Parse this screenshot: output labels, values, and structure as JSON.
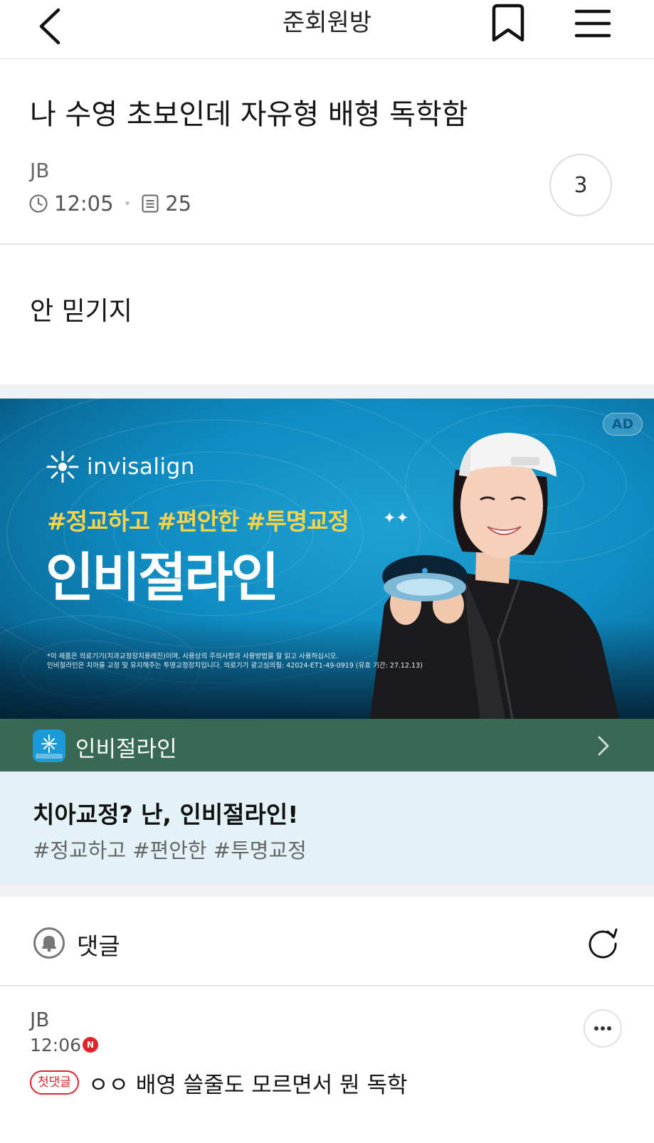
{
  "header": {
    "title": "준회원방"
  },
  "post": {
    "title": "나 수영 초보인데 자유형 배형 독학함",
    "author": "JB",
    "time": "12:05",
    "views": "25",
    "comment_count": "3",
    "body": "안 믿기지"
  },
  "ad": {
    "badge": "AD",
    "brand_logo_text": "invisalign",
    "hashtags": "#정교하고 #편안한 #투명교정",
    "headline": "인비절라인",
    "fine_print_1": "*이 제품은 의료기기(치과교정장치용레진)이며, 사용상의 주의사항과 사용방법을 잘 읽고 사용하십시오.",
    "fine_print_2": "인비절라인은 치아를 교정 및 유지해주는 투명교정장치입니다. 의료기기 광고심의필: 42024-ET1-49-0919 (유효 기간: 27.12.13)",
    "advertiser_name": "인비절라인",
    "copy_title": "치아교정? 난, 인비절라인!",
    "copy_sub": "#정교하고 #편안한 #투명교정"
  },
  "comments": {
    "label": "댓글",
    "items": [
      {
        "author": "JB",
        "time": "12:06",
        "new_badge": "N",
        "tag": "첫댓글",
        "text": "ㅇㅇ 배영 쓸줄도 모르면서 뭔 독학"
      }
    ]
  },
  "colors": {
    "ad_bar": "#376955",
    "ad_copy_bg": "#e2f2f7",
    "accent_red": "#e3232b",
    "hashtag_yellow": "#f6d34a"
  }
}
